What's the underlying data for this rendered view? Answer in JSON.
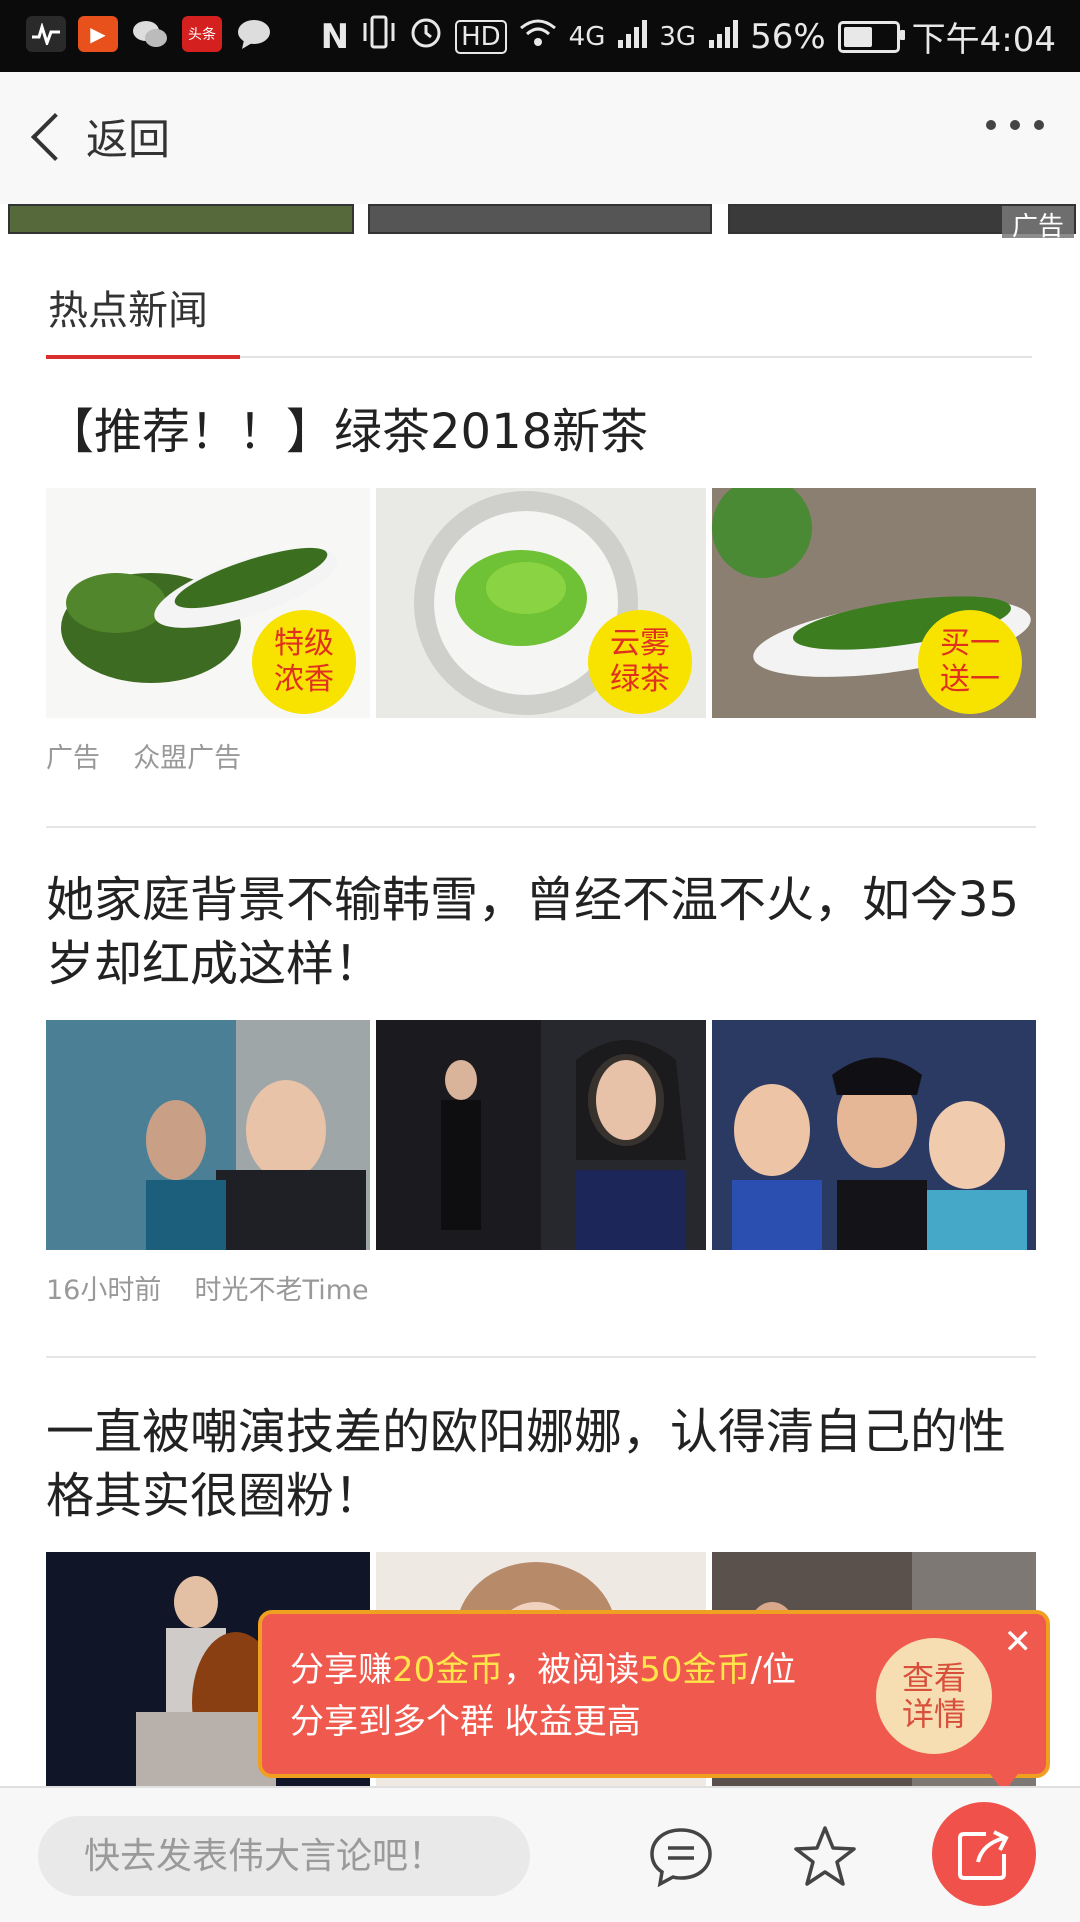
{
  "status_bar": {
    "battery": "56%",
    "time": "下午4:04",
    "signal_a": "4G",
    "signal_b": "3G",
    "hd": "HD"
  },
  "nav": {
    "back_label": "返回"
  },
  "ad_strip": {
    "ad_tag": "广告"
  },
  "section": {
    "title": "热点新闻"
  },
  "articles": [
    {
      "title": "【推荐！！】绿茶2018新茶",
      "badges": [
        "特级\n浓香",
        "云雾\n绿茶",
        "买一\n送一"
      ],
      "meta_left": "广告",
      "meta_right": "众盟广告"
    },
    {
      "title": "她家庭背景不输韩雪，曾经不温不火，如今35岁却红成这样！",
      "meta_left": "16小时前",
      "meta_right": "时光不老Time"
    },
    {
      "title": "一直被嘲演技差的欧阳娜娜，认得清自己的性格其实很圈粉！"
    }
  ],
  "promo": {
    "line1_a": "分享赚",
    "line1_b": "20金币",
    "line1_c": "，被阅读",
    "line1_d": "50金币",
    "line1_e": "/位",
    "line2": "分享到多个群 收益更高",
    "button_line1": "查看",
    "button_line2": "详情"
  },
  "bottom_bar": {
    "comment_placeholder": "快去发表伟大言论吧！"
  },
  "colors": {
    "accent": "#d9302f",
    "promo_bg": "#f05a4e",
    "badge": "#f7e200",
    "share": "#f0514a"
  }
}
